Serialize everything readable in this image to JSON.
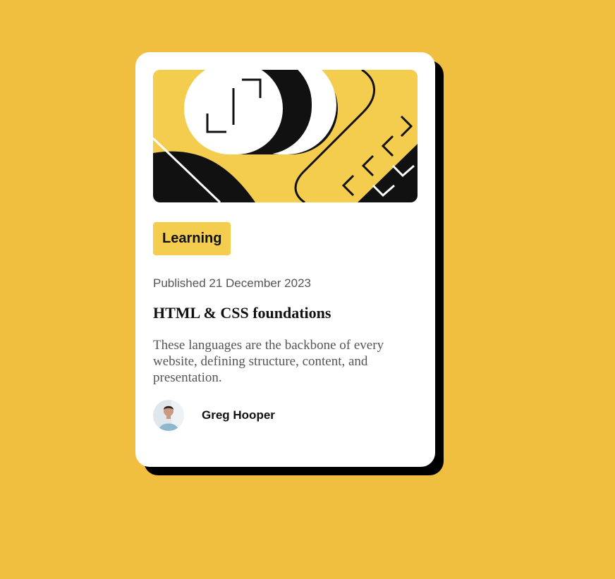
{
  "card": {
    "tag_label": "Learning",
    "published": "Published 21 December 2023",
    "title": "HTML & CSS foundations",
    "description": "These languages are the backbone of every website, defining structure, content, and presentation.",
    "author_name": "Greg Hooper",
    "hero_image": "illustration-article",
    "avatar_image": "author-photo"
  },
  "colors": {
    "background": "#f0bf3f",
    "card": "#ffffff",
    "accent": "#f4cd4f",
    "shadow": "#000000",
    "text_dark": "#111111",
    "text_muted": "#555555"
  }
}
